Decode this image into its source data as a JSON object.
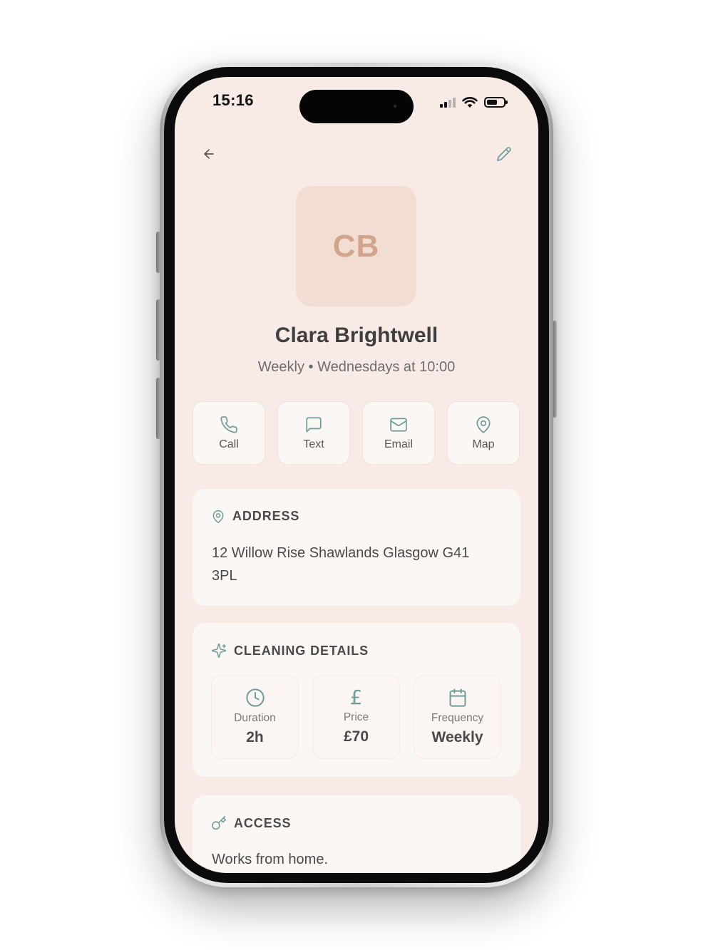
{
  "status_bar": {
    "time": "15:16"
  },
  "client": {
    "initials": "CB",
    "name": "Clara Brightwell",
    "schedule": "Weekly • Wednesdays at 10:00"
  },
  "actions": [
    {
      "label": "Call",
      "icon": "phone-icon"
    },
    {
      "label": "Text",
      "icon": "message-icon"
    },
    {
      "label": "Email",
      "icon": "mail-icon"
    },
    {
      "label": "Map",
      "icon": "map-pin-icon"
    }
  ],
  "address": {
    "title": "ADDRESS",
    "text": "12 Willow Rise Shawlands Glasgow G41 3PL"
  },
  "cleaning_details": {
    "title": "CLEANING DETAILS",
    "duration": {
      "label": "Duration",
      "value": "2h"
    },
    "price": {
      "label": "Price",
      "value": "£70",
      "icon_glyph": "£"
    },
    "frequency": {
      "label": "Frequency",
      "value": "Weekly"
    }
  },
  "access": {
    "title": "ACCESS",
    "text": "Works from home."
  },
  "colors": {
    "screen_bg": "#f8ebe5",
    "accent_teal": "#6f9c9a",
    "avatar_bg": "#f1ddd2",
    "avatar_text": "#d3a38b"
  }
}
